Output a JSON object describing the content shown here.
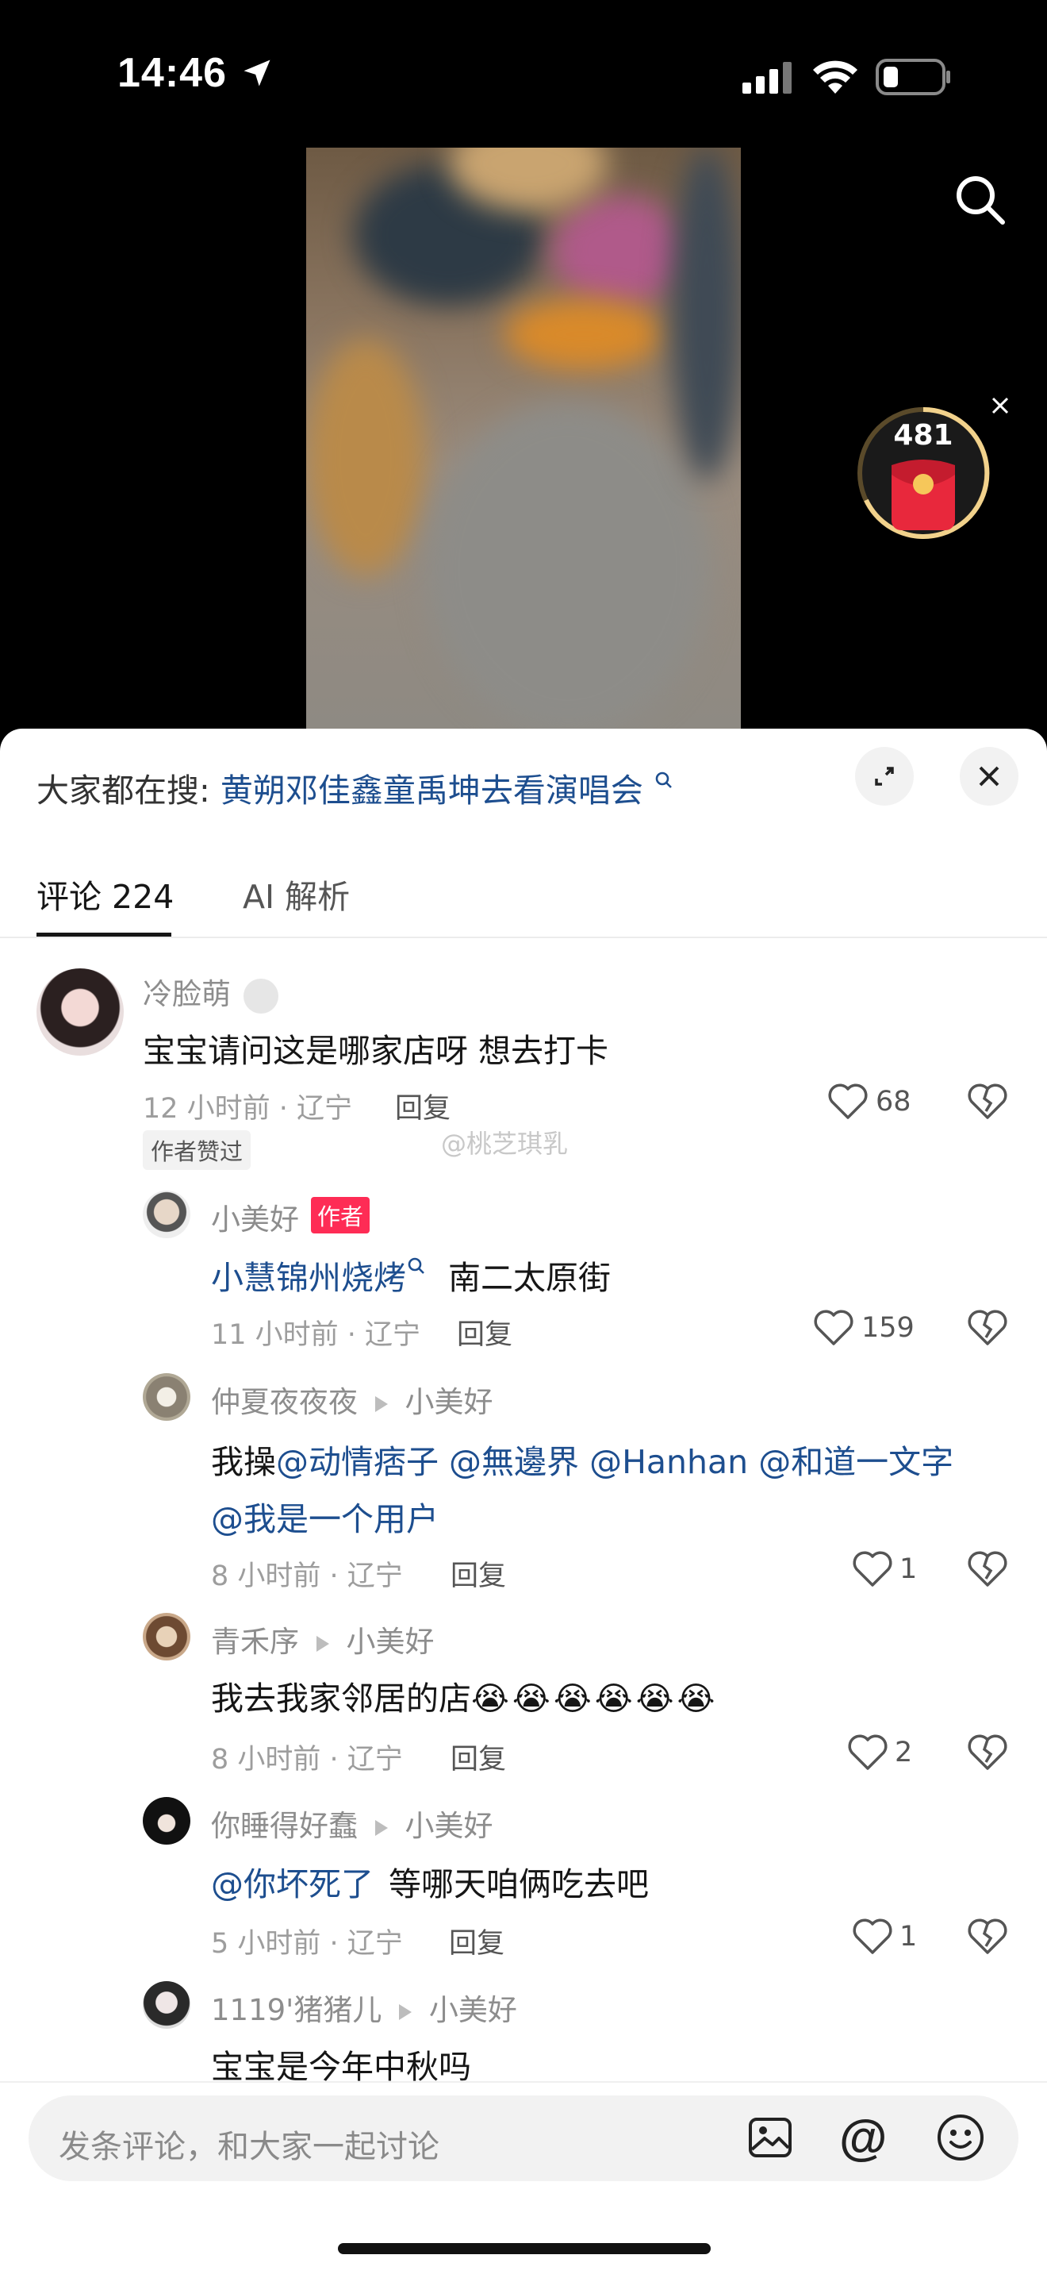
{
  "status_bar": {
    "time": "14:46"
  },
  "badge": {
    "count": "481"
  },
  "search_bar": {
    "label": "大家都在搜:",
    "query": "黄朔邓佳鑫童禹坤去看演唱会"
  },
  "tabs": [
    {
      "label": "评论 224"
    },
    {
      "label": "AI 解析"
    }
  ],
  "watermark": "@桃芝琪乳",
  "comments": [
    {
      "name": "冷脸萌",
      "text": "宝宝请问这是哪家店呀 想去打卡",
      "meta": "12 小时前 · 辽宁",
      "reply": "回复",
      "likes": "68",
      "author_liked": "作者赞过"
    },
    {
      "name": "小美好",
      "author_tag": "作者",
      "link": "小慧锦州烧烤",
      "text": "南二太原街",
      "meta": "11 小时前 · 辽宁",
      "reply": "回复",
      "likes": "159"
    },
    {
      "name": "仲夏夜夜夜",
      "to": "小美好",
      "prefix": "我操",
      "mentions": [
        "@动情痞子",
        "@無邊界",
        "@Hanhan",
        "@和道一文字",
        "@我是一个用户"
      ],
      "meta": "8 小时前 · 辽宁",
      "reply": "回复",
      "likes": "1"
    },
    {
      "name": "青禾序",
      "to": "小美好",
      "text": "我去我家邻居的店",
      "emoji": "😭😭😭😭😭😭",
      "meta": "8 小时前 · 辽宁",
      "reply": "回复",
      "likes": "2"
    },
    {
      "name": "你睡得好蠢",
      "to": "小美好",
      "mention": "@你坏死了",
      "text": "等哪天咱俩吃去吧",
      "meta": "5 小时前 · 辽宁",
      "reply": "回复",
      "likes": "1"
    },
    {
      "name": "1119'猪猪儿",
      "to": "小美好",
      "text": "宝宝是今年中秋吗"
    }
  ],
  "input": {
    "placeholder": "发条评论，和大家一起讨论"
  }
}
